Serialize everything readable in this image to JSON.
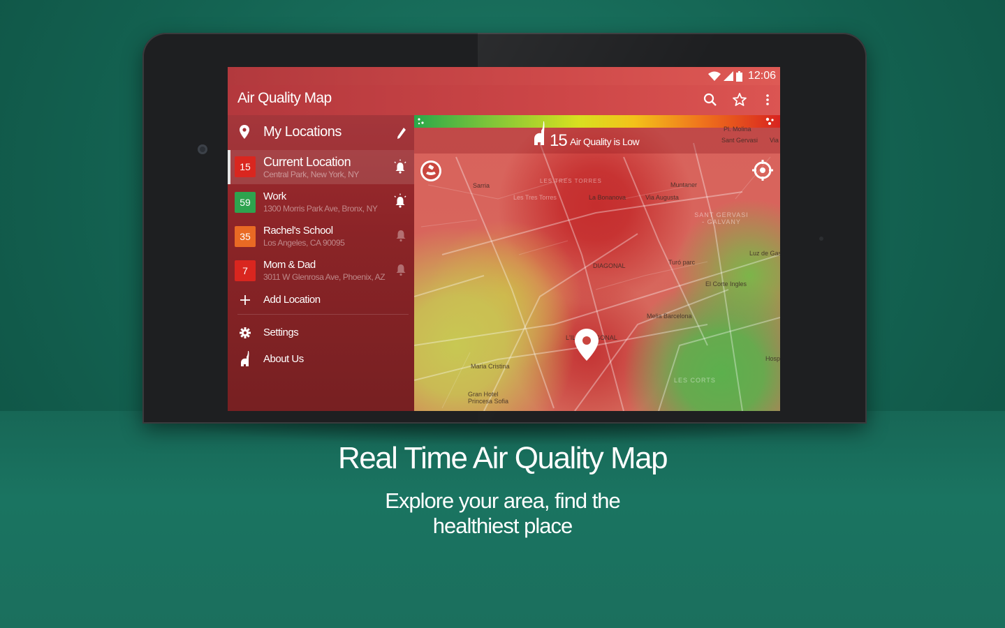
{
  "status_bar": {
    "time": "12:06"
  },
  "app": {
    "title": "Air Quality Map"
  },
  "drawer": {
    "header": "My Locations",
    "locations": [
      {
        "badge": "15",
        "badge_color": "#d9261f",
        "name": "Current Location",
        "address": "Central Park, New York, NY",
        "alert": "bell-active-icon"
      },
      {
        "badge": "59",
        "badge_color": "#2ea34e",
        "name": "Work",
        "address": "1300 Morris Park Ave, Bronx, NY",
        "alert": "bell-active-icon"
      },
      {
        "badge": "35",
        "badge_color": "#e96a24",
        "name": "Rachel's School",
        "address": "Los Angeles, CA 90095",
        "alert": "bell-inactive-icon"
      },
      {
        "badge": "7",
        "badge_color": "#d9261f",
        "name": "Mom & Dad",
        "address": "3011 W Glenrosa Ave, Phoenix, AZ",
        "alert": "bell-inactive-icon"
      }
    ],
    "add_location": "Add Location",
    "settings": "Settings",
    "about": "About Us"
  },
  "map": {
    "aq_value": "15",
    "aq_text": "Air Quality is Low",
    "labels": [
      "Pl. Molina",
      "Sant Gervasi",
      "Via",
      "Sarria",
      "LES TRES TORRES",
      "Les Tres Torres",
      "La Bonanova",
      "Via Augusta",
      "Muntaner",
      "SANT GERVASI - GALVANY",
      "Luz de Gas",
      "Turó parc",
      "El Corte Ingles",
      "Melia Barcelona",
      "L'ILLA DIAGONAL",
      "Hosp",
      "Maria Cristina",
      "Gran Hotel Princesa Sofia",
      "LES CORTS",
      "DIAGONAL"
    ]
  },
  "promo": {
    "headline": "Real Time Air Quality Map",
    "subline_1": "Explore your area, find the",
    "subline_2": "healthiest place"
  },
  "colors": {
    "background": "#136150",
    "toolbar": "#cd4647",
    "drawer": "#8b2427"
  }
}
